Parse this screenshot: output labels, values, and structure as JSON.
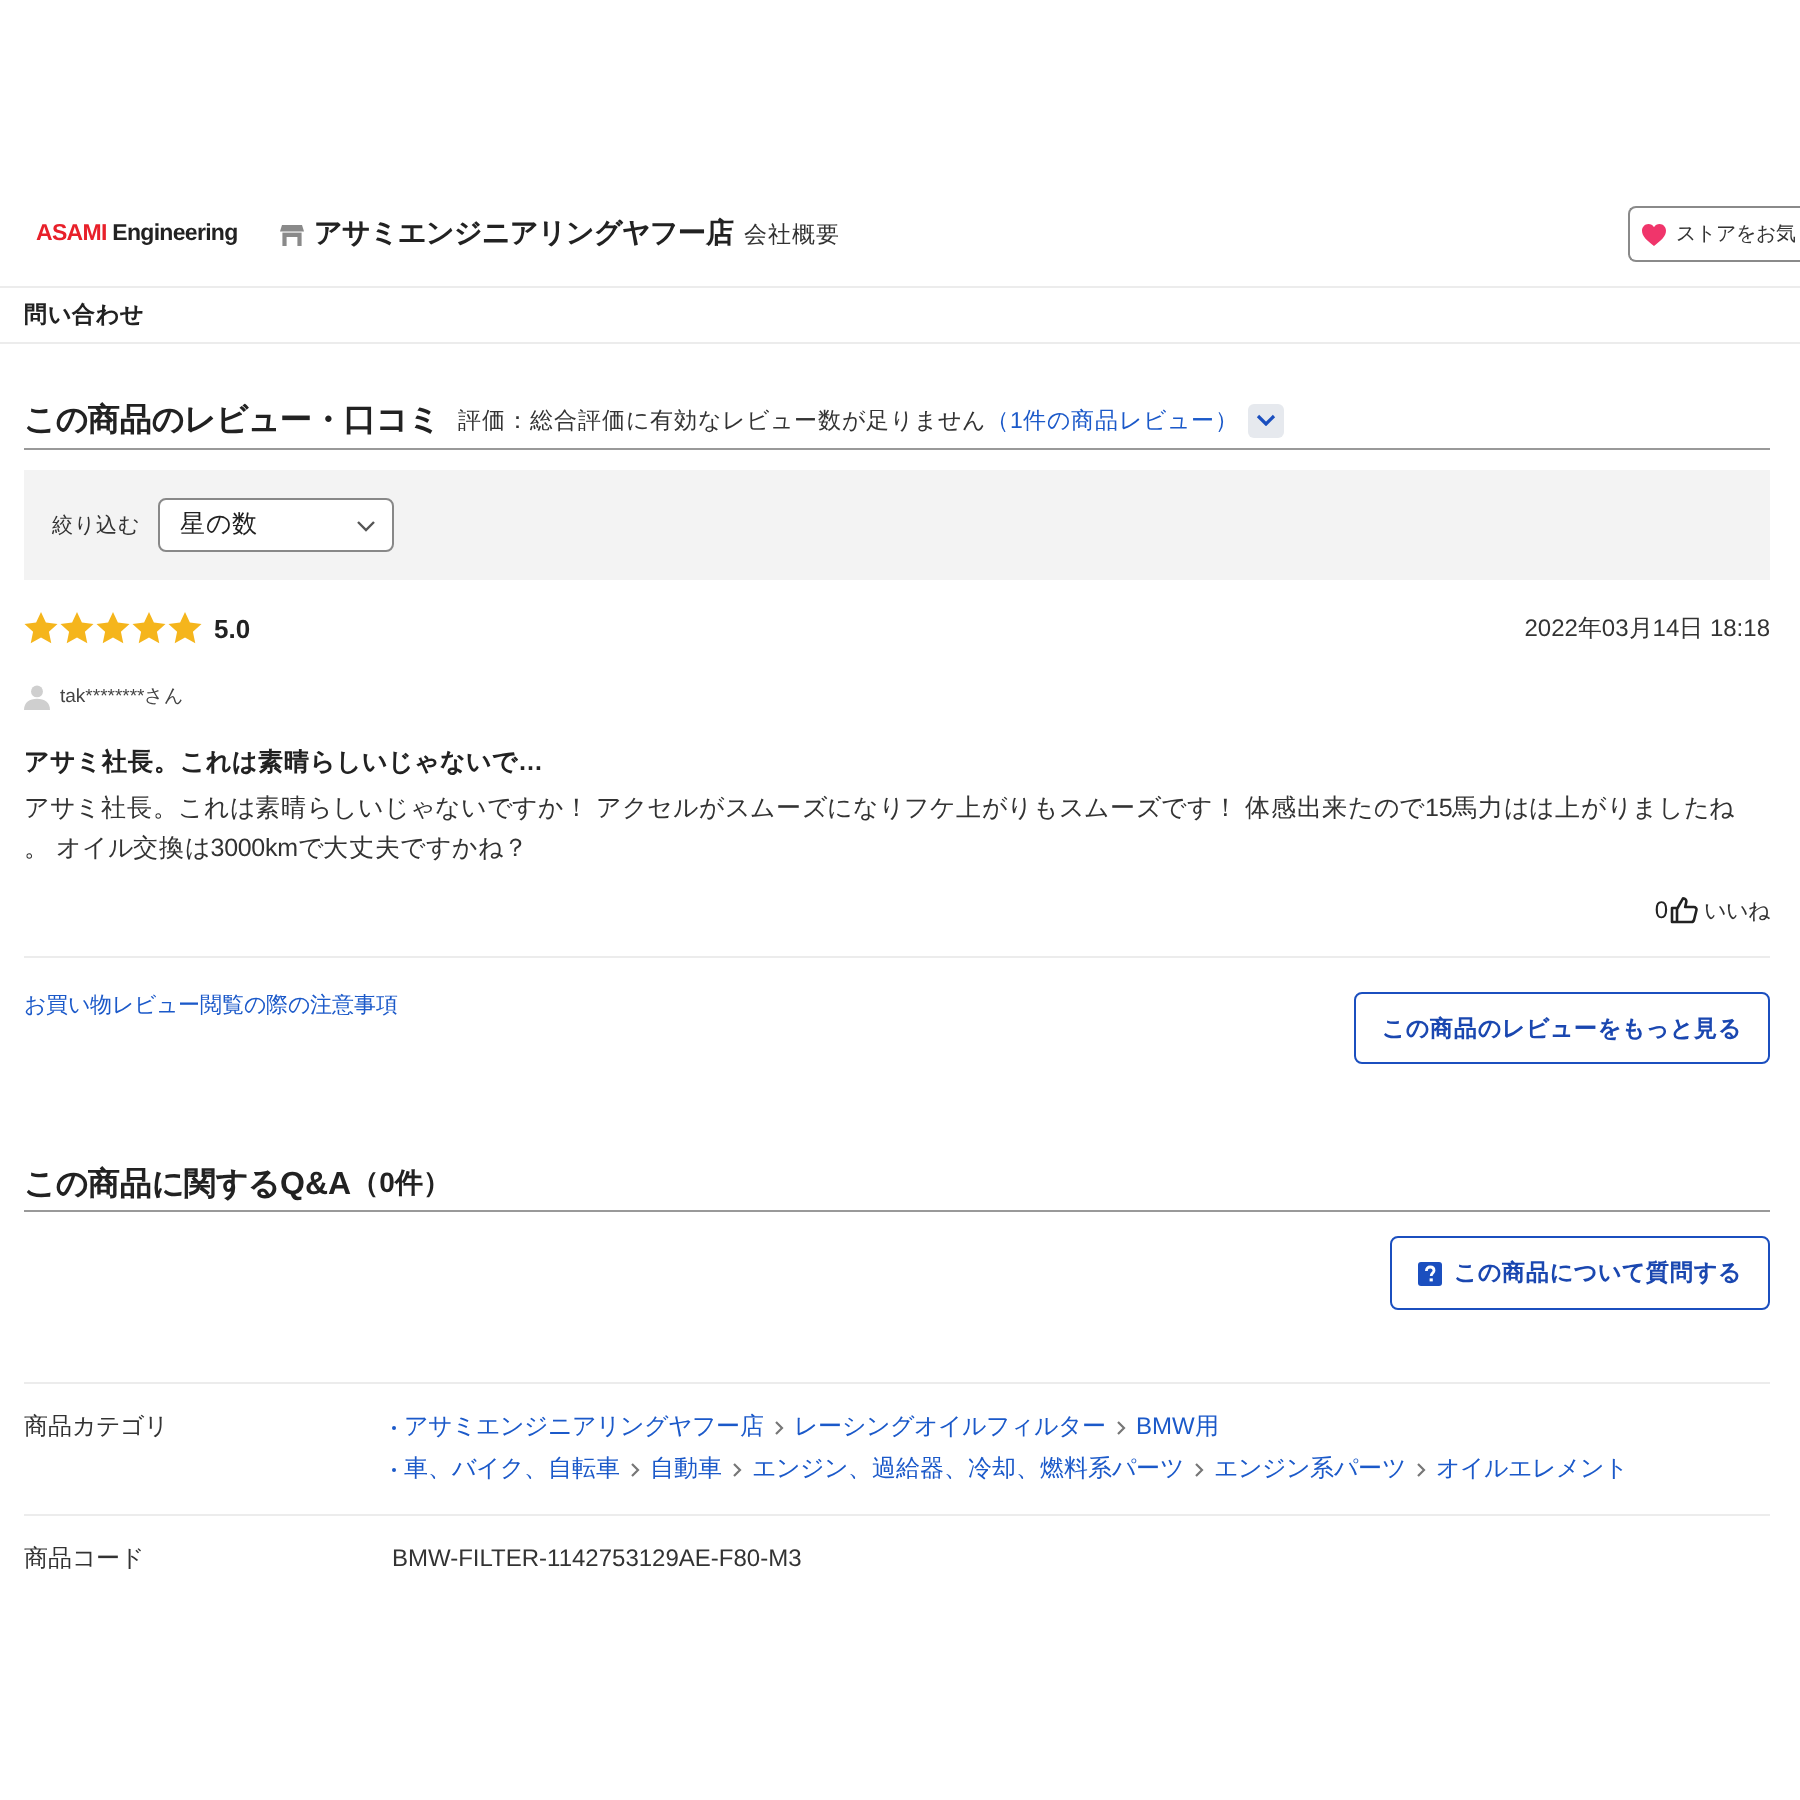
{
  "header": {
    "logo": {
      "brand": "ASAMI",
      "suffix": "Engineering"
    },
    "store_name": "アサミエンジニアリングヤフー店",
    "company_link": "会社概要",
    "favorite_button": "ストアをお気"
  },
  "nav": {
    "contact_link": "問い合わせ"
  },
  "reviews": {
    "title": "この商品のレビュー・口コミ",
    "rating_note": "評価：総合評価に有効なレビュー数が足りません",
    "count_link": "（1件の商品レビュー）",
    "expanded": false,
    "filter": {
      "label": "絞り込む",
      "select_value": "星の数"
    },
    "items": [
      {
        "stars": 5,
        "score": "5.0",
        "date": "2022年03月14日 18:18",
        "user": "tak********さん",
        "title": "アサミ社長。これは素晴らしいじゃないで…",
        "body": "アサミ社長。これは素晴らしいじゃないですか！ アクセルがスムーズになりフケ上がりもスムーズです！ 体感出来たので15馬力はは上がりましたね。 オイル交換は3000kmで大丈夫ですかね？",
        "likes": "0",
        "like_label": "いいね"
      }
    ],
    "guidelines_link": "お買い物レビュー閲覧の際の注意事項",
    "more_button": "この商品のレビューをもっと見る"
  },
  "qa": {
    "title": "この商品に関するQ&A",
    "count": "（0件）",
    "ask_button": "この商品について質問する"
  },
  "details": [
    {
      "kind": "categories",
      "label": "商品カテゴリ",
      "paths": [
        {
          "crumbs": [
            "アサミエンジニアリングヤフー店",
            "レーシングオイルフィルター",
            "BMW用"
          ]
        },
        {
          "crumbs": [
            "車、バイク、自転車",
            "自動車",
            "エンジン、過給器、冷却、燃料系パーツ",
            "エンジン系パーツ",
            "オイルエレメント"
          ]
        }
      ]
    },
    {
      "kind": "text",
      "label": "商品コード",
      "value": "BMW-FILTER-1142753129AE-F80-M3"
    }
  ]
}
